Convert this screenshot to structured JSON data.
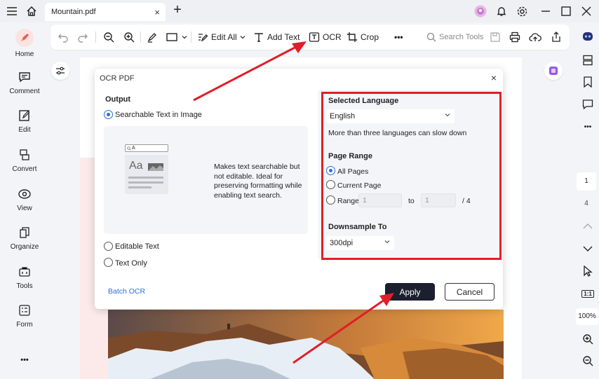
{
  "app": {
    "tab_title": "Mountain.pdf",
    "tab_close": "×",
    "new_tab": "+"
  },
  "left_nav": {
    "items": [
      {
        "label": "Home"
      },
      {
        "label": "Comment"
      },
      {
        "label": "Edit"
      },
      {
        "label": "Convert"
      },
      {
        "label": "View"
      },
      {
        "label": "Organize"
      },
      {
        "label": "Tools"
      },
      {
        "label": "Form"
      }
    ],
    "more": "•••"
  },
  "toolbar": {
    "edit_all": "Edit All",
    "add_text": "Add Text",
    "ocr": "OCR",
    "crop": "Crop",
    "more": "•••",
    "search_placeholder": "Search Tools"
  },
  "page_nav": {
    "current_page": "1",
    "total_pages": "4",
    "fit": "1:1",
    "zoom": "100%"
  },
  "dialog": {
    "title": "OCR PDF",
    "close": "×",
    "output_label": "Output",
    "options": {
      "searchable": "Searchable Text in Image",
      "editable": "Editable Text",
      "text_only": "Text Only"
    },
    "preview": {
      "search_text": "A",
      "glyph_text": "Aa",
      "description": "Makes text searchable but not editable. Ideal for preserving formatting while enabling text search."
    },
    "language": {
      "label": "Selected Language",
      "value": "English",
      "hint": "More than three languages can slow down"
    },
    "page_range": {
      "label": "Page Range",
      "all": "All Pages",
      "current": "Current Page",
      "range": "Range",
      "from": "1",
      "to_label": "to",
      "to": "1",
      "total": "/ 4"
    },
    "downsample": {
      "label": "Downsample To",
      "value": "300dpi"
    },
    "batch_link": "Batch OCR",
    "apply": "Apply",
    "cancel": "Cancel"
  },
  "colors": {
    "accent": "#2b6fd6",
    "highlight_box": "#e01f28",
    "primary_button": "#1b1f2e"
  }
}
